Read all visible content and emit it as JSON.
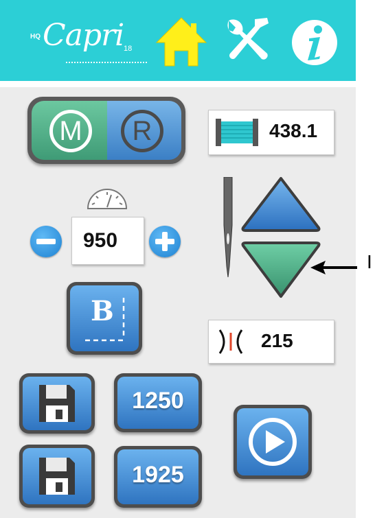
{
  "header": {
    "logo_prefix": "HQ",
    "logo_text": "Capri",
    "logo_suffix": "18",
    "icons": [
      "home-icon",
      "tools-icon",
      "info-icon"
    ],
    "color": "#2ccfd6"
  },
  "mode_toggle": {
    "left_label": "M",
    "right_label": "R"
  },
  "bobbin": {
    "value": "438.1",
    "icon": "bobbin-icon"
  },
  "speed": {
    "value": "950",
    "icon": "speedometer-icon"
  },
  "stitch": {
    "value": "215",
    "icon": "stitch-icon"
  },
  "baste_button": {
    "label": "B"
  },
  "presets": [
    {
      "value": "1250"
    },
    {
      "value": "1925"
    }
  ],
  "needle_controls": {
    "icons": [
      "needle-icon",
      "needle-up-icon",
      "needle-down-icon"
    ]
  },
  "annotation": {
    "label": "I"
  },
  "colors": {
    "blue": "#2f74c0",
    "green": "#3f9b76",
    "frame": "#4d4d4d"
  }
}
